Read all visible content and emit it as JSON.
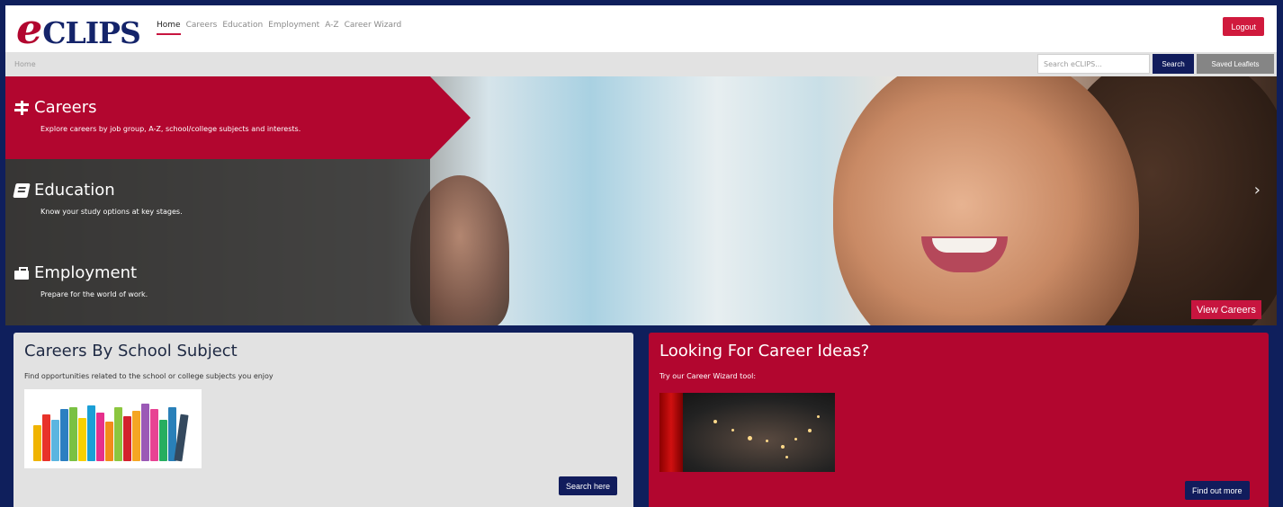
{
  "header": {
    "logo_e": "e",
    "logo_text": "CLIPS",
    "nav": [
      "Home",
      "Careers",
      "Education",
      "Employment",
      "A-Z",
      "Career Wizard"
    ],
    "logout_label": "Logout"
  },
  "crumbbar": {
    "breadcrumb": "Home",
    "search_placeholder": "Search eCLIPS...",
    "search_label": "Search",
    "saved_leaflets_label": "Saved Leaflets"
  },
  "hero": {
    "sections": [
      {
        "title": "Careers",
        "desc": "Explore careers by job group, A-Z, school/college subjects and interests.",
        "icon": "signpost-icon"
      },
      {
        "title": "Education",
        "desc": "Know your study options at key stages.",
        "icon": "book-icon"
      },
      {
        "title": "Employment",
        "desc": "Prepare for the world of work.",
        "icon": "briefcase-icon"
      }
    ],
    "next_arrow": "›",
    "view_careers_label": "View Careers"
  },
  "cards": {
    "subject": {
      "title": "Careers By School Subject",
      "desc": "Find opportunities related to the school or college subjects you enjoy",
      "button": "Search here"
    },
    "ideas": {
      "title": "Looking For Career Ideas?",
      "desc": "Try our Career Wizard tool:",
      "button": "Find out more"
    }
  },
  "colors": {
    "brand_red": "#b2062f",
    "navy": "#111c5c",
    "frame": "#0f1f5c"
  }
}
